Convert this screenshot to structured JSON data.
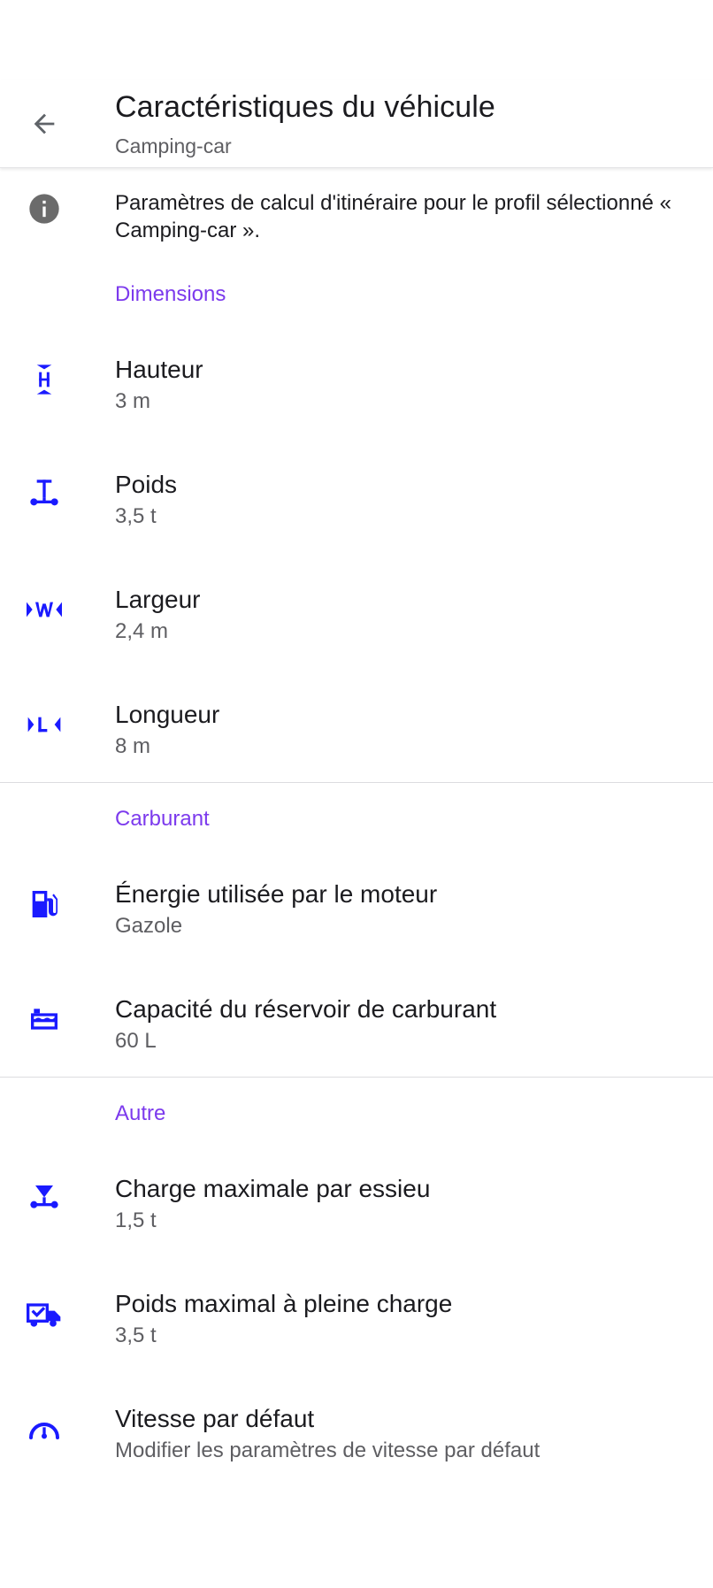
{
  "header": {
    "title": "Caractéristiques du véhicule",
    "subtitle": "Camping-car"
  },
  "info": {
    "text": "Paramètres de calcul d'itinéraire pour le profil sélectionné « Camping-car »."
  },
  "colors": {
    "accent": "#7c3aed",
    "icon": "#1a1aff",
    "info_icon": "#6b6b6b"
  },
  "sections": {
    "dimensions": {
      "title": "Dimensions",
      "items": [
        {
          "icon": "height-icon",
          "label": "Hauteur",
          "value": "3 m"
        },
        {
          "icon": "weight-icon",
          "label": "Poids",
          "value": "3,5 t"
        },
        {
          "icon": "width-icon",
          "label": "Largeur",
          "value": "2,4 m"
        },
        {
          "icon": "length-icon",
          "label": "Longueur",
          "value": "8 m"
        }
      ]
    },
    "fuel": {
      "title": "Carburant",
      "items": [
        {
          "icon": "fuel-pump-icon",
          "label": "Énergie utilisée par le moteur",
          "value": "Gazole"
        },
        {
          "icon": "fuel-tank-icon",
          "label": "Capacité du réservoir de carburant",
          "value": "60 L"
        }
      ]
    },
    "other": {
      "title": "Autre",
      "items": [
        {
          "icon": "axle-load-icon",
          "label": "Charge maximale par essieu",
          "value": "1,5 t"
        },
        {
          "icon": "truck-load-icon",
          "label": "Poids maximal à pleine charge",
          "value": "3,5 t"
        },
        {
          "icon": "speedometer-icon",
          "label": "Vitesse par défaut",
          "value": "Modifier les paramètres de vitesse par défaut"
        }
      ]
    }
  }
}
